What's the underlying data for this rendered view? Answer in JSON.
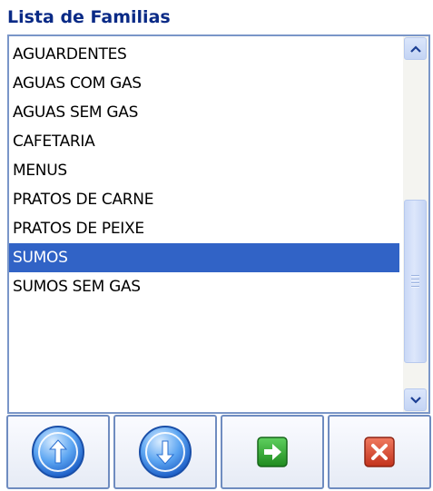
{
  "title": "Lista de Familias",
  "list": {
    "items": [
      {
        "label": "AGUARDENTES",
        "selected": false
      },
      {
        "label": "AGUAS COM GAS",
        "selected": false
      },
      {
        "label": "AGUAS SEM GAS",
        "selected": false
      },
      {
        "label": "CAFETARIA",
        "selected": false
      },
      {
        "label": "MENUS",
        "selected": false
      },
      {
        "label": "PRATOS DE CARNE",
        "selected": false
      },
      {
        "label": "PRATOS DE PEIXE",
        "selected": false
      },
      {
        "label": "SUMOS",
        "selected": true
      },
      {
        "label": "SUMOS SEM GAS",
        "selected": false
      }
    ]
  },
  "toolbar": {
    "buttons": [
      {
        "name": "move-up-button",
        "icon": "arrow-up-circle-icon"
      },
      {
        "name": "move-down-button",
        "icon": "arrow-down-circle-icon"
      },
      {
        "name": "confirm-button",
        "icon": "green-arrow-right-icon"
      },
      {
        "name": "close-button",
        "icon": "red-x-icon"
      }
    ]
  },
  "colors": {
    "title": "#0a2a86",
    "selection": "#3163c6",
    "list_border": "#7a96c8",
    "confirm_green": "#2e9b2e",
    "close_red": "#d8432c"
  }
}
